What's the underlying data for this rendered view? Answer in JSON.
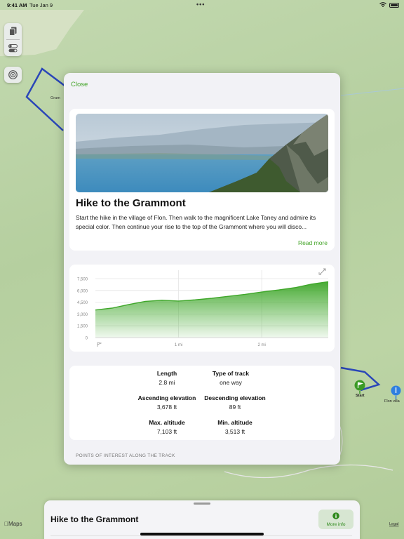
{
  "status_bar": {
    "time": "9:41 AM",
    "date": "Tue Jan 9",
    "dots": "•••"
  },
  "map": {
    "labels": {
      "gramm": "Gram",
      "start": "Start",
      "flon": "Flon villa"
    },
    "brand": "Maps",
    "legal": "Legal"
  },
  "modal": {
    "close_label": "Close",
    "hike": {
      "title": "Hike to the Grammont",
      "description": "Start the hike in the village of Flon. Then walk to the magnificent Lake Taney and admire its special color. Then continue your rise to the top of the Grammont where you will disco...",
      "read_more": "Read more"
    },
    "stats": {
      "length": {
        "label": "Length",
        "value": "2.8 mi"
      },
      "track_type": {
        "label": "Type of track",
        "value": "one way"
      },
      "ascending": {
        "label": "Ascending elevation",
        "value": "3,678 ft"
      },
      "descending": {
        "label": "Descending elevation",
        "value": "89 ft"
      },
      "max_alt": {
        "label": "Max. altitude",
        "value": "7,103 ft"
      },
      "min_alt": {
        "label": "Min. altitude",
        "value": "3,513 ft"
      }
    },
    "poi_header": "POINTS OF INTEREST ALONG THE TRACK"
  },
  "chart_data": {
    "type": "area",
    "x": [
      0,
      0.2,
      0.4,
      0.6,
      0.8,
      1.0,
      1.2,
      1.4,
      1.6,
      1.8,
      2.0,
      2.2,
      2.4,
      2.6,
      2.8
    ],
    "y": [
      3513,
      3750,
      4200,
      4600,
      4750,
      4650,
      4800,
      5000,
      5250,
      5500,
      5800,
      6050,
      6350,
      6800,
      7103
    ],
    "ylim": [
      0,
      7500
    ],
    "y_ticks": [
      "0",
      "1,500",
      "3,000",
      "4,500",
      "6,000",
      "7,500"
    ],
    "x_ticks": [
      "1 mi",
      "2 mi"
    ],
    "grid": true,
    "color": "#3fa72a"
  },
  "sheet": {
    "title": "Hike to the Grammont",
    "more_info": "More info"
  },
  "colors": {
    "accent": "#43a428",
    "route": "#2a46b8"
  }
}
